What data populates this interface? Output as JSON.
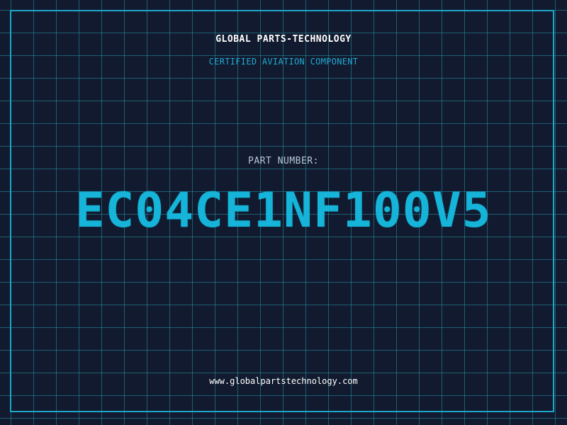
{
  "header": {
    "company": "GLOBAL PARTS-TECHNOLOGY",
    "subtitle": "CERTIFIED AVIATION COMPONENT"
  },
  "part": {
    "label": "PART NUMBER:",
    "number": "EC04CE1NF100V5"
  },
  "footer": {
    "website": "www.globalpartstechnology.com"
  },
  "colors": {
    "background": "#111a2e",
    "grid": "#2896aa",
    "accent": "#1fa6c9",
    "part_number": "#15b4d8",
    "text": "#ffffff"
  }
}
